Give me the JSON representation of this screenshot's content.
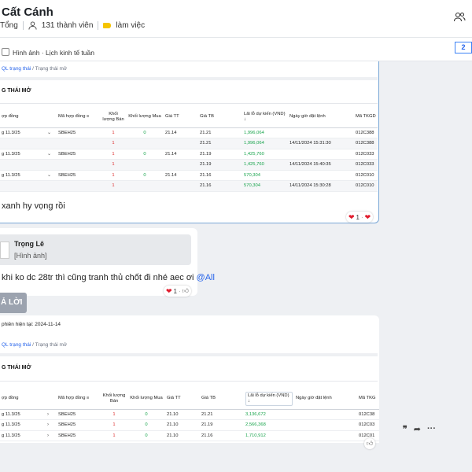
{
  "header": {
    "title": "Cất Cánh",
    "group_type": "Tổng",
    "members": "131 thành viên",
    "label_tag": "làm việc"
  },
  "pinned": {
    "text": "Hình ảnh · Lịch kinh tế tuần",
    "page_badge": "2"
  },
  "colors": {
    "accent": "#2563eb",
    "profit": "#16a34a",
    "qty": "#dc2626",
    "tag": "#f5c400"
  },
  "message1": {
    "crumb_link": "QL trạng thái",
    "crumb_current": "Trạng thái mở",
    "section_title": "G THÁI MỞ",
    "columns": [
      "ợp đồng",
      "Mã hợp đồng",
      "Khối lượng Bán",
      "Khối lượng Mua",
      "Giá TT",
      "Giá TB",
      "Lãi lỗ dự kiến (VND)",
      "Ngày giờ đặt lệnh",
      "Mã TKGD"
    ],
    "rows": [
      {
        "kind": "main",
        "c0": "g 11.3/25",
        "chev": "⌄",
        "c1": "SBEH25",
        "c2": "1",
        "c3": "0",
        "c4": "21.14",
        "c5": "21.21",
        "c6": "1,996,064",
        "c7": "",
        "c8": "012C388"
      },
      {
        "kind": "sub",
        "c0": "",
        "chev": "",
        "c1": "",
        "c2": "1",
        "c3": "",
        "c4": "",
        "c5": "21.21",
        "c6": "1,996,064",
        "c7": "14/11/2024 15:31:30",
        "c8": "012C388"
      },
      {
        "kind": "main",
        "c0": "g 11.3/25",
        "chev": "⌄",
        "c1": "SBEH25",
        "c2": "1",
        "c3": "0",
        "c4": "21.14",
        "c5": "21.19",
        "c6": "1,425,760",
        "c7": "",
        "c8": "012C033"
      },
      {
        "kind": "sub",
        "c0": "",
        "chev": "",
        "c1": "",
        "c2": "1",
        "c3": "",
        "c4": "",
        "c5": "21.19",
        "c6": "1,425,760",
        "c7": "14/11/2024 15:40:35",
        "c8": "012C033"
      },
      {
        "kind": "main",
        "c0": "g 11.3/25",
        "chev": "⌄",
        "c1": "SBEH25",
        "c2": "1",
        "c3": "0",
        "c4": "21.14",
        "c5": "21.16",
        "c6": "570,304",
        "c7": "",
        "c8": "012C010"
      },
      {
        "kind": "sub",
        "c0": "",
        "chev": "",
        "c1": "",
        "c2": "1",
        "c3": "",
        "c4": "",
        "c5": "21.16",
        "c6": "570,304",
        "c7": "14/11/2024 15:30:28",
        "c8": "012C010"
      }
    ],
    "text": "xanh hy vọng rồi",
    "reaction_count": "1"
  },
  "message2": {
    "quote_name": "Trọng Lê",
    "quote_sub": "[Hình ảnh]",
    "text": "khi ko dc 28tr thì cũng tranh thủ chốt đi nhé aec ơi",
    "mention": "@All",
    "reaction_count": "1"
  },
  "reply_button": "Ả LỜI",
  "message3": {
    "session": "phiên hiện tại: 2024-11-14",
    "crumb_link": "QL trạng thái",
    "crumb_current": "Trạng thái mở",
    "section_title": "G THÁI MỞ",
    "columns": [
      "ợp đồng",
      "Mã hợp đồng",
      "Khối lượng Bán",
      "Khối lượng Mua",
      "Giá TT",
      "Giá TB",
      "Lãi lỗ dự kiến (VND)",
      "Ngày giờ đặt lệnh",
      "Mã TKG"
    ],
    "rows": [
      {
        "c0": "g 11.3/25",
        "chev": "›",
        "c1": "SBEH25",
        "c2": "1",
        "c3": "0",
        "c4": "21.10",
        "c5": "21.21",
        "c6": "3,136,672",
        "c7": "",
        "c8": "012C38"
      },
      {
        "c0": "g 11.3/25",
        "chev": "›",
        "c1": "SBEH25",
        "c2": "1",
        "c3": "0",
        "c4": "21.10",
        "c5": "21.19",
        "c6": "2,566,368",
        "c7": "",
        "c8": "012C03"
      },
      {
        "c0": "g 11.3/25",
        "chev": "›",
        "c1": "SBEH25",
        "c2": "1",
        "c3": "0",
        "c4": "21.10",
        "c5": "21.16",
        "c6": "1,710,912",
        "c7": "",
        "c8": "012C01"
      }
    ]
  }
}
